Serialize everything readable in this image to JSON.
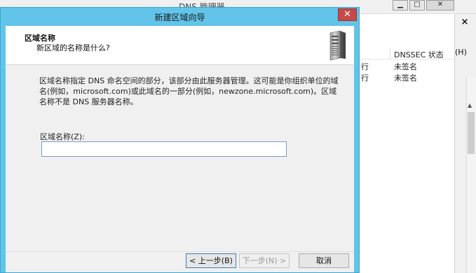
{
  "background_window": {
    "title": "DNS 管理器",
    "controls": {
      "minimize": "▁",
      "maximize": "□",
      "close": "✕"
    },
    "panel_close": "×",
    "help_menu": "(H)",
    "list": {
      "columns": [
        "DNSSEC 状态"
      ],
      "rows": [
        {
          "col_a": "行",
          "dnssec": "未签名"
        },
        {
          "col_a": "行",
          "dnssec": "未签名"
        }
      ]
    },
    "scroll_up_glyph": "▲"
  },
  "wizard": {
    "title": "新建区域向导",
    "close_glyph": "✕",
    "heading": "区域名称",
    "subheading": "新区域的名称是什么?",
    "description": "区域名称指定 DNS 命名空间的部分，该部分由此服务器管理。这可能是你组织单位的域名(例如，microsoft.com)或此域名的一部分(例如，newzone.microsoft.com)。区域名称不是 DNS 服务器名称。",
    "zone_name_label": "区域名称(Z):",
    "zone_name_value": "",
    "zone_name_placeholder": "",
    "buttons": {
      "back": "< 上一步(B)",
      "next": "下一步(N) >",
      "cancel": "取消"
    },
    "icon": "server-tower-icon"
  },
  "colors": {
    "wizard_frame": "#61c4e8",
    "close_button": "#c74949",
    "dialog_body": "#f0f0f0",
    "input_border": "#7a9cc8"
  }
}
